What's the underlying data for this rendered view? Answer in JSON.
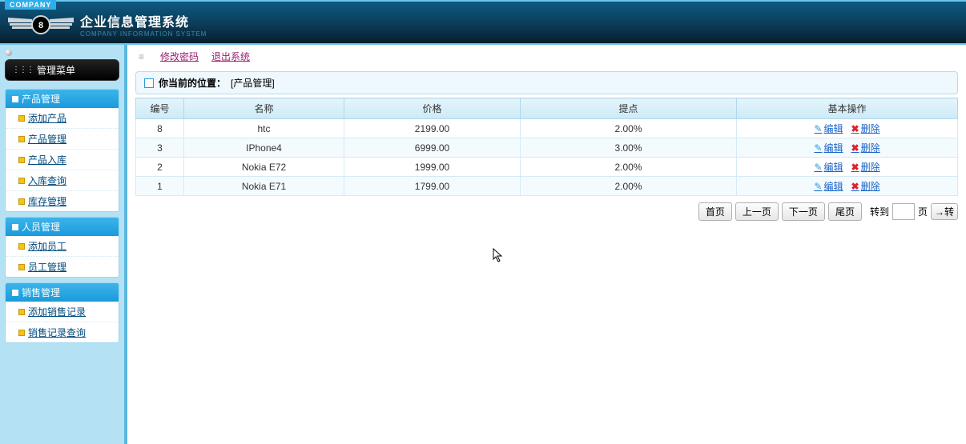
{
  "header": {
    "company_tag": "COMPANY",
    "title": "企业信息管理系统",
    "subtitle": "COMPANY INFORMATION SYSTEM"
  },
  "top_links": {
    "change_pwd": "修改密码",
    "logout": "退出系统"
  },
  "sidebar": {
    "menu_header": "管理菜单",
    "sections": [
      {
        "title": "产品管理",
        "items": [
          "添加产品",
          "产品管理",
          "产品入库",
          "入库查询",
          "库存管理"
        ]
      },
      {
        "title": "人员管理",
        "items": [
          "添加员工",
          "员工管理"
        ]
      },
      {
        "title": "销售管理",
        "items": [
          "添加销售记录",
          "销售记录查询"
        ]
      }
    ]
  },
  "breadcrumb": {
    "label": "你当前的位置：",
    "value": "[产品管理]"
  },
  "table": {
    "columns": [
      "编号",
      "名称",
      "价格",
      "提点",
      "基本操作"
    ],
    "rows": [
      {
        "id": "8",
        "name": "htc",
        "price": "2199.00",
        "rate": "2.00%"
      },
      {
        "id": "3",
        "name": "IPhone4",
        "price": "6999.00",
        "rate": "3.00%"
      },
      {
        "id": "2",
        "name": "Nokia E72",
        "price": "1999.00",
        "rate": "2.00%"
      },
      {
        "id": "1",
        "name": "Nokia E71",
        "price": "1799.00",
        "rate": "2.00%"
      }
    ],
    "op_edit": "编辑",
    "op_delete": "删除"
  },
  "pager": {
    "first": "首页",
    "prev": "上一页",
    "next": "下一页",
    "last": "尾页",
    "goto_label": "转到",
    "page_suffix": "页",
    "go": "→转"
  }
}
